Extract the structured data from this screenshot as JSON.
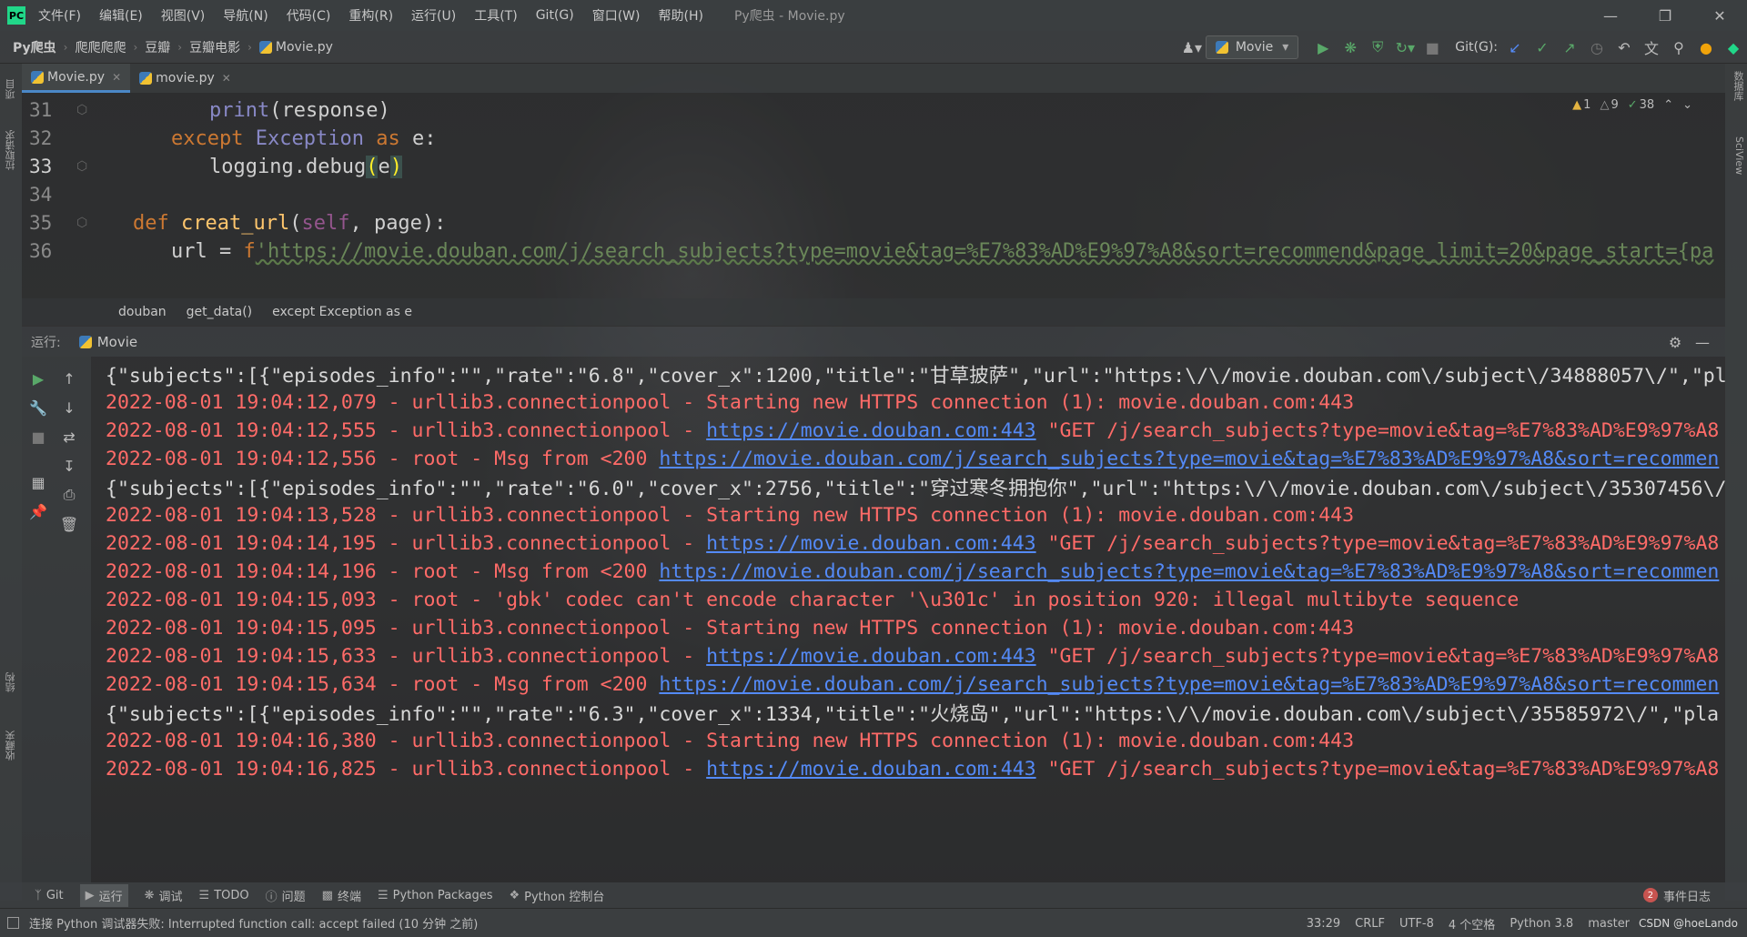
{
  "window": {
    "title": "Py爬虫 - Movie.py",
    "menu": [
      "文件(F)",
      "编辑(E)",
      "视图(V)",
      "导航(N)",
      "代码(C)",
      "重构(R)",
      "运行(U)",
      "工具(T)",
      "Git(G)",
      "窗口(W)",
      "帮助(H)"
    ],
    "logo_text": "PC"
  },
  "nav": {
    "breadcrumbs": [
      "Py爬虫",
      "爬爬爬爬",
      "豆瓣",
      "豆瓣电影",
      "Movie.py"
    ],
    "run_config": "Movie",
    "git_label": "Git(G):"
  },
  "editor_tabs": [
    {
      "label": "Movie.py",
      "active": true
    },
    {
      "label": "movie.py",
      "active": false
    }
  ],
  "inspections": {
    "warnings": "1",
    "weak_warnings": "9",
    "ok": "38"
  },
  "code": {
    "line_numbers": [
      "31",
      "32",
      "33",
      "34",
      "35",
      "36"
    ],
    "l31": {
      "fn": "print",
      "rest": "(response)"
    },
    "l32": {
      "kw1": "except",
      "cls": "Exception",
      "kw2": "as",
      "rest": "e:"
    },
    "l33": {
      "call": "logging.debug",
      "open": "(",
      "arg": "e",
      "close": ")"
    },
    "l35": {
      "kw": "def",
      "fn": "creat_url",
      "open": "(",
      "self": "self",
      "rest": ", page):"
    },
    "l36": {
      "lhs": "url = ",
      "prefix": "f",
      "str": "'https://movie.douban.com/j/search_subjects?type=movie&tag=%E7%83%AD%E9%97%A8&sort=recommend&page_limit=20&page_start={pa"
    }
  },
  "code_breadcrumb": [
    "douban",
    "get_data()",
    "except Exception as e"
  ],
  "run_panel": {
    "label": "运行:",
    "tab": "Movie"
  },
  "console": {
    "l1": "{\"subjects\":[{\"episodes_info\":\"\",\"rate\":\"6.8\",\"cover_x\":1200,\"title\":\"甘草披萨\",\"url\":\"https:\\/\\/movie.douban.com\\/subject\\/34888057\\/\",\"pl",
    "l2": "2022-08-01 19:04:12,079 - urllib3.connectionpool - Starting new HTTPS connection (1): movie.douban.com:443",
    "l3a": "2022-08-01 19:04:12,555 - urllib3.connectionpool - ",
    "l3link": "https://movie.douban.com:443",
    "l3b": " \"GET /j/search_subjects?type=movie&tag=%E7%83%AD%E9%97%A8",
    "l4a": "2022-08-01 19:04:12,556 - root - Msg from <200 ",
    "l4link": "https://movie.douban.com/j/search_subjects?type=movie&tag=%E7%83%AD%E9%97%A8&sort=recommen",
    "l5": "{\"subjects\":[{\"episodes_info\":\"\",\"rate\":\"6.0\",\"cover_x\":2756,\"title\":\"穿过寒冬拥抱你\",\"url\":\"https:\\/\\/movie.douban.com\\/subject\\/35307456\\/",
    "l6": "2022-08-01 19:04:13,528 - urllib3.connectionpool - Starting new HTTPS connection (1): movie.douban.com:443",
    "l7a": "2022-08-01 19:04:14,195 - urllib3.connectionpool - ",
    "l7link": "https://movie.douban.com:443",
    "l7b": " \"GET /j/search_subjects?type=movie&tag=%E7%83%AD%E9%97%A8",
    "l8a": "2022-08-01 19:04:14,196 - root - Msg from <200 ",
    "l8link": "https://movie.douban.com/j/search_subjects?type=movie&tag=%E7%83%AD%E9%97%A8&sort=recommen",
    "l9": "2022-08-01 19:04:15,093 - root - 'gbk' codec can't encode character '\\u301c' in position 920: illegal multibyte sequence",
    "l10": "2022-08-01 19:04:15,095 - urllib3.connectionpool - Starting new HTTPS connection (1): movie.douban.com:443",
    "l11a": "2022-08-01 19:04:15,633 - urllib3.connectionpool - ",
    "l11link": "https://movie.douban.com:443",
    "l11b": " \"GET /j/search_subjects?type=movie&tag=%E7%83%AD%E9%97%A8",
    "l12a": "2022-08-01 19:04:15,634 - root - Msg from <200 ",
    "l12link": "https://movie.douban.com/j/search_subjects?type=movie&tag=%E7%83%AD%E9%97%A8&sort=recommen",
    "l13": "{\"subjects\":[{\"episodes_info\":\"\",\"rate\":\"6.3\",\"cover_x\":1334,\"title\":\"火烧岛\",\"url\":\"https:\\/\\/movie.douban.com\\/subject\\/35585972\\/\",\"pla",
    "l14": "2022-08-01 19:04:16,380 - urllib3.connectionpool - Starting new HTTPS connection (1): movie.douban.com:443",
    "l15a": "2022-08-01 19:04:16,825 - urllib3.connectionpool - ",
    "l15link": "https://movie.douban.com:443",
    "l15b": " \"GET /j/search_subjects?type=movie&tag=%E7%83%AD%E9%97%A8"
  },
  "left_strip": {
    "project": "项目",
    "pull_requests": "拉取请求",
    "structure": "结构",
    "favorites": "收藏夹"
  },
  "right_strip": {
    "database": "数据库",
    "sciview": "SciView"
  },
  "tool_windows": [
    "Git",
    "运行",
    "调试",
    "TODO",
    "问题",
    "终端",
    "Python Packages",
    "Python 控制台"
  ],
  "event_log": {
    "count": "2",
    "label": "事件日志"
  },
  "status": {
    "message": "连接 Python 调试器失败: Interrupted function call: accept failed (10 分钟 之前)",
    "position": "33:29",
    "line_sep": "CRLF",
    "encoding": "UTF-8",
    "indent": "4 个空格",
    "interpreter": "Python 3.8",
    "branch": "master",
    "watermark": "CSDN @hoeLando"
  },
  "colors": {
    "accent": "#4a88c7",
    "error_text": "#ff6b68",
    "link": "#548af7",
    "keyword": "#cc7832"
  }
}
